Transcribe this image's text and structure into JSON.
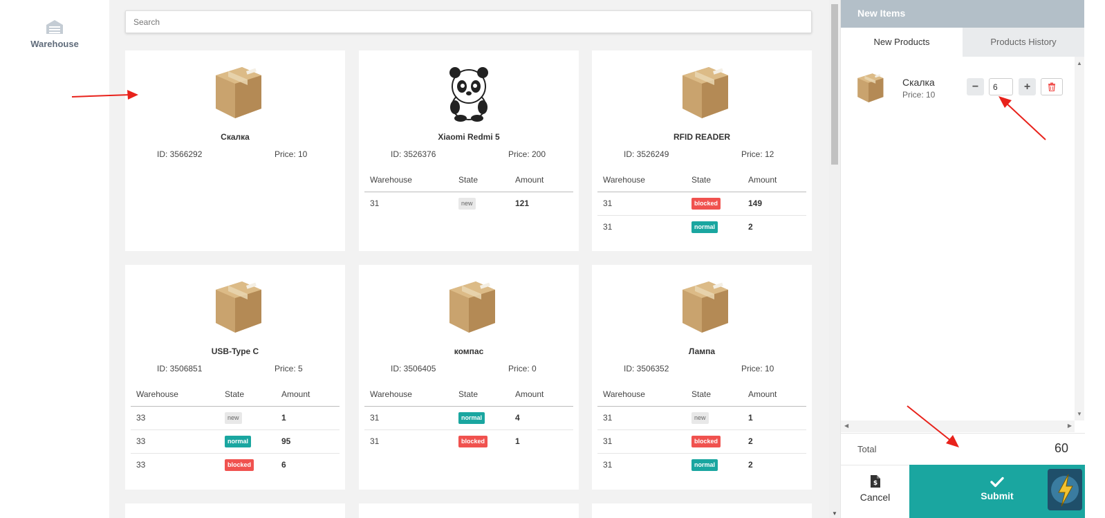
{
  "nav": {
    "warehouse_label": "Warehouse"
  },
  "search": {
    "placeholder": "Search"
  },
  "labels": {
    "id_prefix": "ID: ",
    "price_prefix": "Price: "
  },
  "table_headers": {
    "warehouse": "Warehouse",
    "state": "State",
    "amount": "Amount"
  },
  "products": [
    {
      "name": "Скалка",
      "id": "ID: 3566292",
      "price": "Price: 10",
      "image": "box-icon",
      "rows": []
    },
    {
      "name": "Xiaomi Redmi 5",
      "id": "ID: 3526376",
      "price": "Price: 200",
      "image": "panda-icon",
      "rows": [
        {
          "warehouse": "31",
          "state": "new",
          "amount": "121"
        }
      ]
    },
    {
      "name": "RFID READER",
      "id": "ID: 3526249",
      "price": "Price: 12",
      "image": "box-icon",
      "rows": [
        {
          "warehouse": "31",
          "state": "blocked",
          "amount": "149"
        },
        {
          "warehouse": "31",
          "state": "normal",
          "amount": "2"
        }
      ]
    },
    {
      "name": "USB-Type C",
      "id": "ID: 3506851",
      "price": "Price: 5",
      "image": "box-icon",
      "rows": [
        {
          "warehouse": "33",
          "state": "new",
          "amount": "1"
        },
        {
          "warehouse": "33",
          "state": "normal",
          "amount": "95"
        },
        {
          "warehouse": "33",
          "state": "blocked",
          "amount": "6"
        }
      ]
    },
    {
      "name": "компас",
      "id": "ID: 3506405",
      "price": "Price: 0",
      "image": "box-icon",
      "rows": [
        {
          "warehouse": "31",
          "state": "normal",
          "amount": "4"
        },
        {
          "warehouse": "31",
          "state": "blocked",
          "amount": "1"
        }
      ]
    },
    {
      "name": "Лампа",
      "id": "ID: 3506352",
      "price": "Price: 10",
      "image": "box-icon",
      "rows": [
        {
          "warehouse": "31",
          "state": "new",
          "amount": "1"
        },
        {
          "warehouse": "31",
          "state": "blocked",
          "amount": "2"
        },
        {
          "warehouse": "31",
          "state": "normal",
          "amount": "2"
        }
      ]
    }
  ],
  "panel": {
    "header": "New Items",
    "tabs": [
      {
        "label": "New Products",
        "active": true
      },
      {
        "label": "Products History",
        "active": false
      }
    ],
    "item": {
      "name": "Скалка",
      "price": "Price: 10",
      "quantity": "6"
    },
    "total_label": "Total",
    "total_value": "60",
    "cancel_label": "Cancel",
    "submit_label": "Submit"
  },
  "colors": {
    "accent": "#1aa6a0",
    "blocked": "#f0524f",
    "header": "#b3bfc8"
  }
}
